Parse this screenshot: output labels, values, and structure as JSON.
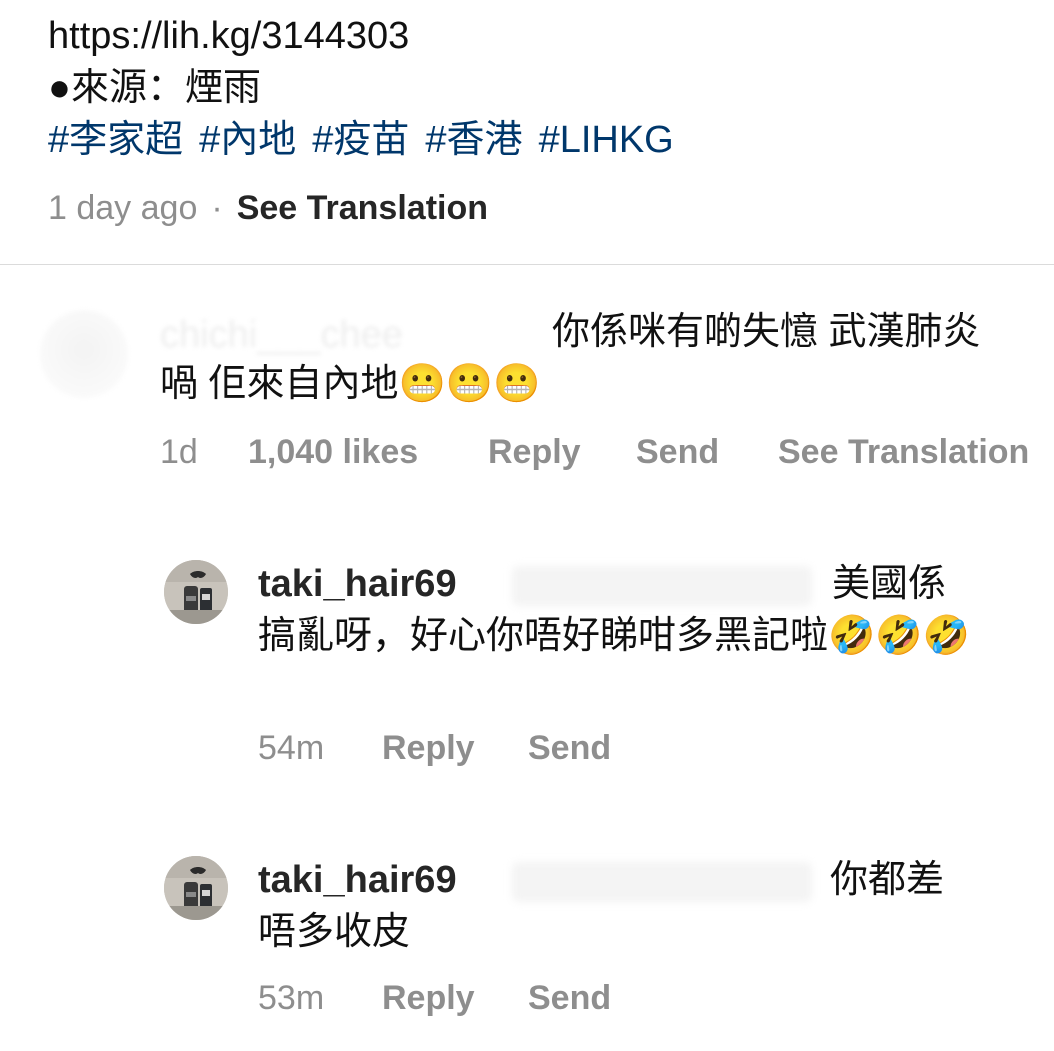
{
  "post": {
    "caption_link": "https://lih.kg/3144303",
    "caption_source": "●來源：煙雨",
    "hashtags": [
      "#李家超",
      "#內地",
      "#疫苗",
      "#香港",
      "#LIHKG"
    ],
    "time": "1 day ago",
    "separator": "·",
    "see_translation": "See Translation"
  },
  "comments": [
    {
      "username": "chichi___chee",
      "text": "你係咪有啲失憶 武漢肺炎喎 佢來自內地😬😬😬",
      "time": "1d",
      "likes": "1,040 likes",
      "reply_label": "Reply",
      "send_label": "Send",
      "see_translation": "See Translation"
    }
  ],
  "replies": [
    {
      "username": "taki_hair69",
      "text": "美國係搞亂呀，好心你唔好睇咁多黑記啦🤣🤣🤣",
      "time": "54m",
      "reply_label": "Reply",
      "send_label": "Send"
    },
    {
      "username": "taki_hair69",
      "text": "你都差唔多收皮",
      "time": "53m",
      "reply_label": "Reply",
      "send_label": "Send"
    }
  ]
}
